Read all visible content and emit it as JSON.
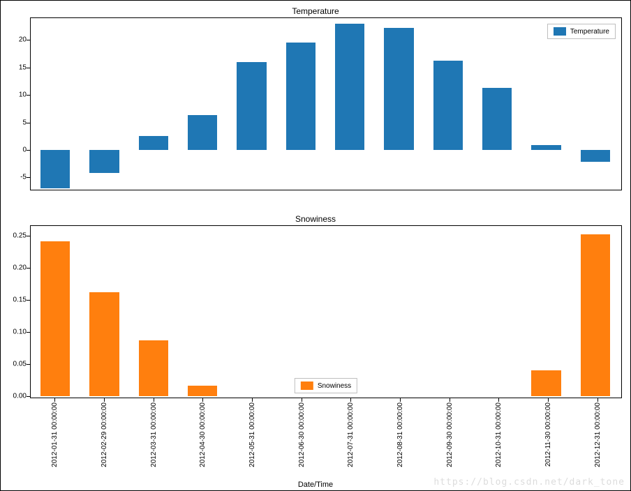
{
  "chart_data": [
    {
      "type": "bar",
      "title": "Temperature",
      "xlabel": "",
      "ylabel": "",
      "legend": "Temperature",
      "ylim": [
        -7,
        24
      ],
      "yticks": [
        -5,
        0,
        5,
        10,
        15,
        20
      ],
      "categories": [
        "2012-01-31 00:00:00",
        "2012-02-29 00:00:00",
        "2012-03-31 00:00:00",
        "2012-04-30 00:00:00",
        "2012-05-31 00:00:00",
        "2012-06-30 00:00:00",
        "2012-07-31 00:00:00",
        "2012-08-31 00:00:00",
        "2012-09-30 00:00:00",
        "2012-10-31 00:00:00",
        "2012-11-30 00:00:00",
        "2012-12-31 00:00:00"
      ],
      "values": [
        -7.0,
        -4.2,
        2.5,
        6.3,
        16.0,
        19.6,
        23.0,
        22.2,
        16.2,
        11.3,
        0.9,
        -2.2
      ],
      "color": "#1f77b4"
    },
    {
      "type": "bar",
      "title": "Snowiness",
      "xlabel": "Date/Time",
      "ylabel": "",
      "legend": "Snowiness",
      "ylim": [
        0,
        0.265
      ],
      "yticks": [
        0.0,
        0.05,
        0.1,
        0.15,
        0.2,
        0.25
      ],
      "categories": [
        "2012-01-31 00:00:00",
        "2012-02-29 00:00:00",
        "2012-03-31 00:00:00",
        "2012-04-30 00:00:00",
        "2012-05-31 00:00:00",
        "2012-06-30 00:00:00",
        "2012-07-31 00:00:00",
        "2012-08-31 00:00:00",
        "2012-09-30 00:00:00",
        "2012-10-31 00:00:00",
        "2012-11-30 00:00:00",
        "2012-12-31 00:00:00"
      ],
      "values": [
        0.241,
        0.162,
        0.087,
        0.016,
        0.0,
        0.0,
        0.0,
        0.0,
        0.0,
        0.0,
        0.04,
        0.252
      ],
      "color": "#ff7f0e"
    }
  ],
  "xlabel_title": "Date/Time",
  "watermark": "https://blog.csdn.net/dark_tone"
}
